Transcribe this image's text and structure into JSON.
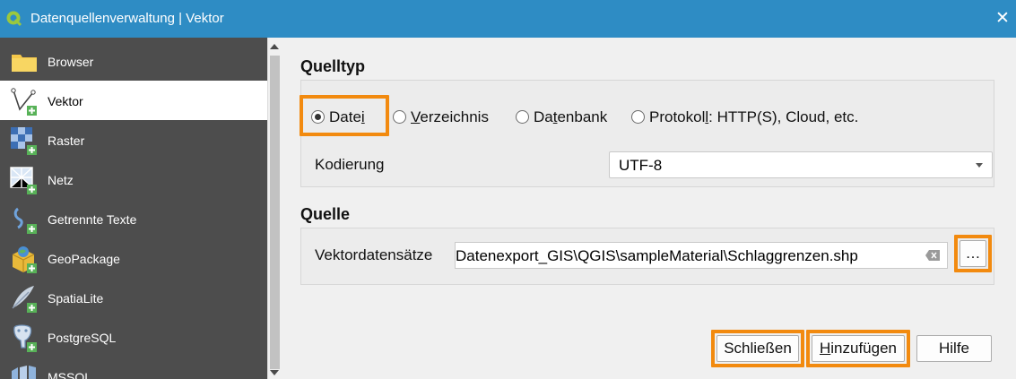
{
  "window": {
    "title": "Datenquellenverwaltung | Vektor",
    "close_symbol": "✕",
    "accent": "#2e8cc4",
    "highlight": "#f28a0f"
  },
  "sidebar": {
    "items": [
      {
        "label": "Browser",
        "icon": "folder-icon"
      },
      {
        "label": "Vektor",
        "icon": "vector-icon"
      },
      {
        "label": "Raster",
        "icon": "raster-icon"
      },
      {
        "label": "Netz",
        "icon": "mesh-icon"
      },
      {
        "label": "Getrennte Texte",
        "icon": "delimited-text-icon"
      },
      {
        "label": "GeoPackage",
        "icon": "geopackage-icon"
      },
      {
        "label": "SpatiaLite",
        "icon": "spatialite-icon"
      },
      {
        "label": "PostgreSQL",
        "icon": "postgresql-icon"
      },
      {
        "label": "MSSQL",
        "icon": "mssql-icon"
      }
    ],
    "active": "Vektor"
  },
  "source_type": {
    "heading": "Quelltyp",
    "options": {
      "file_a": "Date",
      "file_b": "i",
      "dir_a": "",
      "dir_b": "V",
      "dir_c": "erzeichnis",
      "db_a": "Da",
      "db_b": "t",
      "db_c": "enbank",
      "proto_a": "Protokol",
      "proto_b": "l",
      "proto_c": ": HTTP(S), Cloud, etc."
    },
    "selected": "Datei",
    "encoding_label": "Kodierung",
    "encoding_value": "UTF-8"
  },
  "source": {
    "heading": "Quelle",
    "datasets_label": "Vektordatensätze",
    "path_value": "Datenexport_GIS\\QGIS\\sampleMaterial\\Schlaggrenzen.shp",
    "browse_label": "…"
  },
  "buttons": {
    "close": "Schließen",
    "add_a": "H",
    "add_b": "inzufügen",
    "help": "Hilfe"
  }
}
